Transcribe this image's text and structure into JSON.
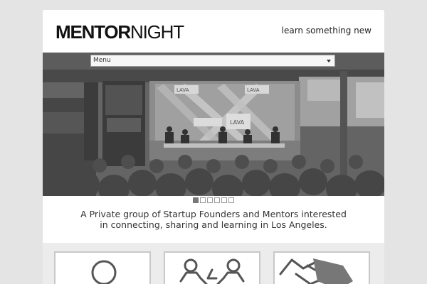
{
  "header": {
    "logo_bold": "MENTOR",
    "logo_light": "NIGHT",
    "tagline": "learn something new"
  },
  "nav": {
    "menu_label": "Menu"
  },
  "slider": {
    "banner_left": "LAVA",
    "banner_right": "LAVA",
    "banner_center": "LAVA",
    "slide_count": 6,
    "active_slide": 1
  },
  "intro": {
    "line1": "A Private group of Startup Founders and Mentors interested",
    "line2": "in connecting, sharing and learning in Los Angeles."
  },
  "features": [
    {
      "icon": "person-icon"
    },
    {
      "icon": "collaboration-icon"
    },
    {
      "icon": "handshake-icon"
    }
  ]
}
